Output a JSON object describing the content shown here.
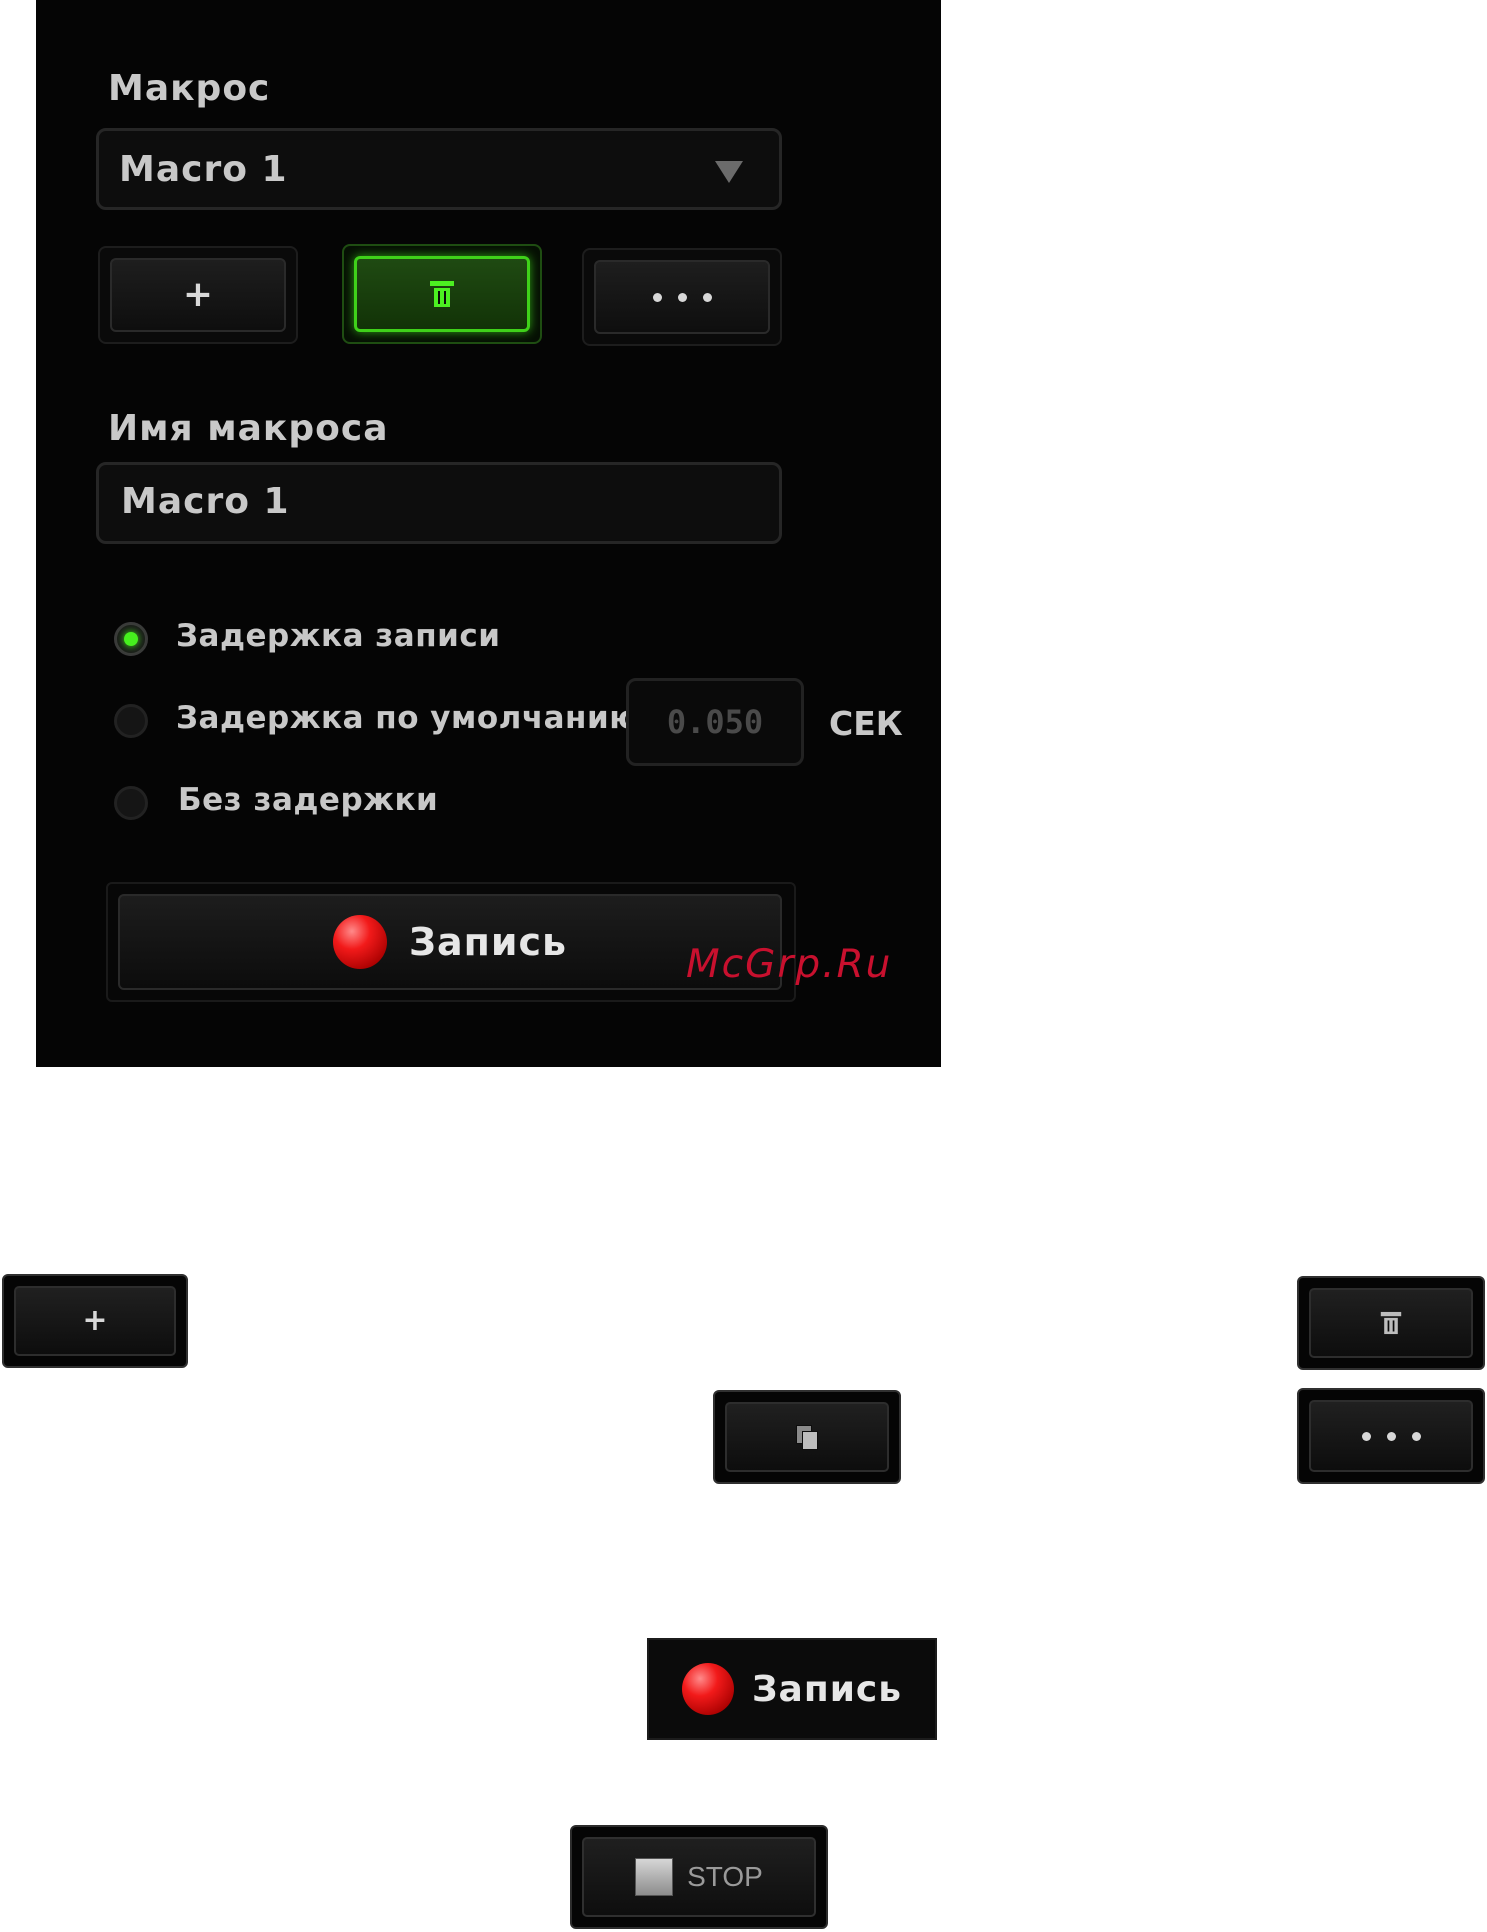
{
  "panel": {
    "macro_label": "Макрос",
    "macro_select_value": "Macro 1",
    "macro_name_label": "Имя макроса",
    "macro_name_value": "Macro 1",
    "add_label": "+",
    "delay_options": [
      {
        "label": "Задержка записи",
        "selected": true
      },
      {
        "label": "Задержка по умолчанию",
        "selected": false
      },
      {
        "label": "Без задержки",
        "selected": false
      }
    ],
    "default_delay_value": "0.050",
    "delay_unit": "СЕК",
    "record_label": "Запись",
    "watermark": "McGrp.Ru"
  },
  "buttons": {
    "add_label": "+",
    "record_label": "Запись",
    "stop_label": "STOP"
  },
  "colors": {
    "accent_green": "#46f01e",
    "record_red": "#f21a1a",
    "panel_bg": "#050505"
  }
}
